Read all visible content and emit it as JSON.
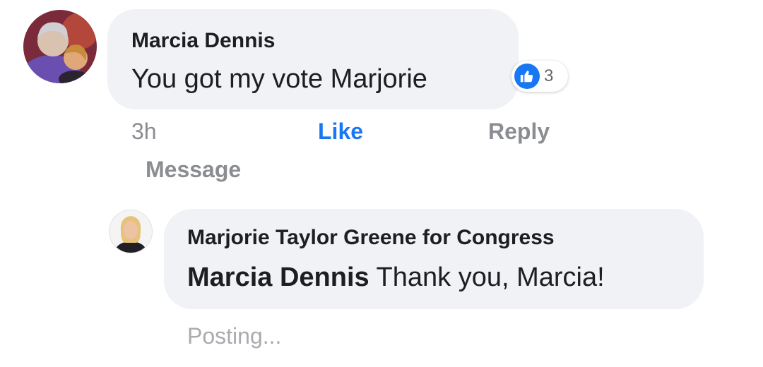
{
  "comment": {
    "author": "Marcia Dennis",
    "text": "You got my vote Marjorie",
    "reactions": {
      "icon": "thumbs-up-icon",
      "count": "3",
      "color": "#1877f2"
    },
    "actions": {
      "time": "3h",
      "like": "Like",
      "reply": "Reply",
      "message": "Message"
    }
  },
  "reply": {
    "author": "Marjorie Taylor Greene for Congress",
    "mention": "Marcia Dennis",
    "text": "Thank you, Marcia!",
    "status": "Posting..."
  },
  "colors": {
    "bubble": "#f0f2f5",
    "accent": "#1877f2",
    "muted": "#8a8d91"
  }
}
